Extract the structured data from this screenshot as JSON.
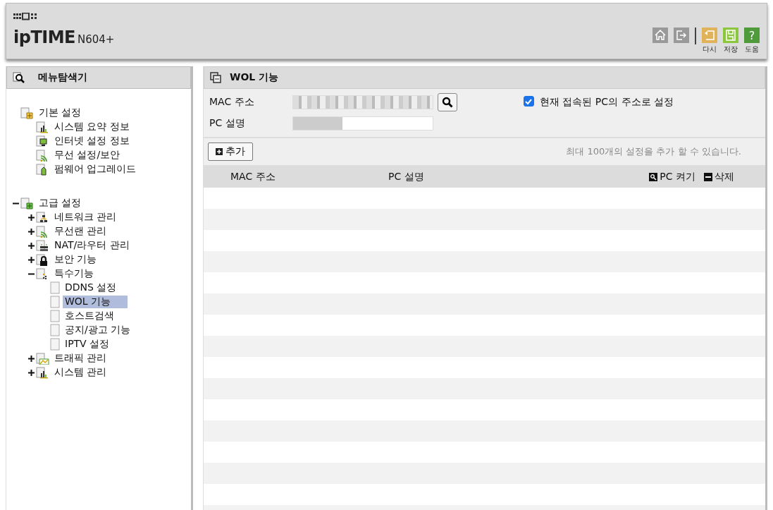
{
  "header": {
    "logo_mark": "ipTIME",
    "model": "N604+",
    "tools": [
      {
        "kind": "home"
      },
      {
        "kind": "logout"
      },
      {
        "kind": "undo",
        "label": "다시",
        "color": "#e0b35a"
      },
      {
        "kind": "save",
        "label": "저장",
        "color": "#8cc63f"
      },
      {
        "kind": "help",
        "label": "도움",
        "color": "#4f9a3a",
        "glyph": "?"
      }
    ]
  },
  "sidebar": {
    "title": "메뉴탐색기",
    "tree": [
      {
        "label": "기본 설정",
        "kind": "folder-basic",
        "selected": false,
        "children": [
          {
            "label": "시스템 요약 정보",
            "kind": "chart",
            "selected": false
          },
          {
            "label": "인터넷 설정 정보",
            "kind": "monitor",
            "selected": false
          },
          {
            "label": "무선 설정/보안",
            "kind": "wifi",
            "selected": false
          },
          {
            "label": "펌웨어 업그레이드",
            "kind": "upgrade",
            "selected": false
          }
        ]
      },
      {
        "label": "고급 설정",
        "kind": "folder-advanced",
        "expanded": true,
        "selected": false,
        "children": [
          {
            "label": "네트워크 관리",
            "kind": "network",
            "expanded": false,
            "selected": false
          },
          {
            "label": "무선랜 관리",
            "kind": "wifi",
            "expanded": false,
            "selected": false
          },
          {
            "label": "NAT/라우터 관리",
            "kind": "router",
            "expanded": false,
            "selected": false
          },
          {
            "label": "보안 기능",
            "kind": "lock",
            "expanded": false,
            "selected": false
          },
          {
            "label": "특수기능",
            "kind": "special",
            "expanded": true,
            "selected": false,
            "children": [
              {
                "label": "DDNS 설정",
                "kind": "page",
                "selected": false
              },
              {
                "label": "WOL 기능",
                "kind": "page",
                "selected": true
              },
              {
                "label": "호스트검색",
                "kind": "page",
                "selected": false
              },
              {
                "label": "공지/광고 기능",
                "kind": "page",
                "selected": false
              },
              {
                "label": "IPTV 설정",
                "kind": "page",
                "selected": false
              }
            ]
          },
          {
            "label": "트래픽 관리",
            "kind": "traffic",
            "expanded": false,
            "selected": false
          },
          {
            "label": "시스템 관리",
            "kind": "chart",
            "expanded": false,
            "selected": false
          }
        ]
      }
    ]
  },
  "main": {
    "title": "WOL 기능",
    "form": {
      "mac_label": "MAC 주소",
      "desc_label": "PC 설명",
      "use_current_label": "현재 접속된 PC의 주소로 설정",
      "use_current_checked": true
    },
    "add_button": "추가",
    "limit_note": "최대 100개의 설정을 추가 할 수 있습니다.",
    "table": {
      "columns": [
        "MAC 주소",
        "PC 설명"
      ],
      "actions": [
        {
          "kind": "wake",
          "label": "PC 켜기"
        },
        {
          "kind": "delete",
          "label": "삭제"
        }
      ]
    }
  }
}
